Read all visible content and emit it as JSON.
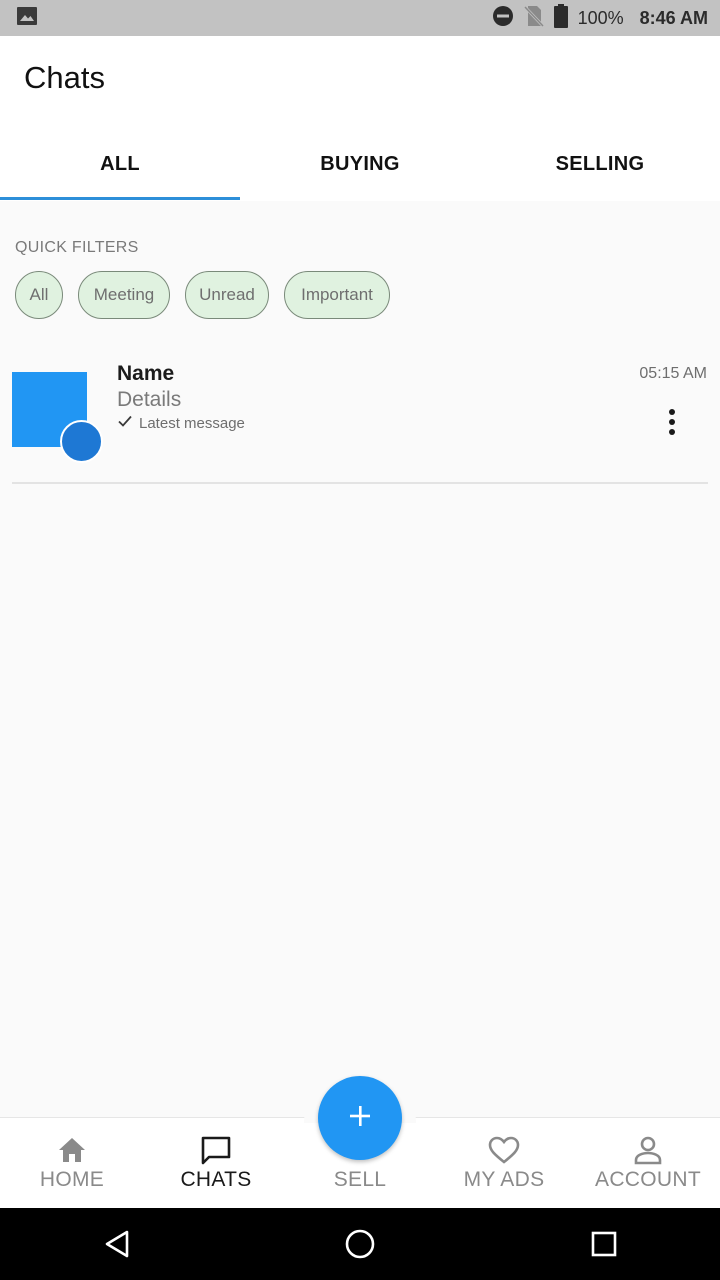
{
  "status_bar": {
    "battery": "100%",
    "time": "8:46 AM",
    "icons": [
      "image-icon",
      "do-not-disturb-icon",
      "no-sim-icon",
      "battery-icon"
    ]
  },
  "header": {
    "title": "Chats"
  },
  "tabs": [
    {
      "label": "ALL",
      "active": true
    },
    {
      "label": "BUYING",
      "active": false
    },
    {
      "label": "SELLING",
      "active": false
    }
  ],
  "accent_color": "#2196f3",
  "quick_filters": {
    "label": "QUICK FILTERS",
    "chips": [
      "All",
      "Meeting",
      "Unread",
      "Important"
    ]
  },
  "chats": [
    {
      "name": "Name",
      "details": "Details",
      "latest_message": "Latest message",
      "time": "05:15 AM",
      "read_icon": "check-icon",
      "menu_icon": "more-vert-icon"
    }
  ],
  "bottom_nav": {
    "items": [
      {
        "label": "HOME",
        "icon": "home-icon",
        "active": false
      },
      {
        "label": "CHATS",
        "icon": "chat-bubble-icon",
        "active": true
      },
      {
        "label": "SELL",
        "icon": "plus-icon",
        "active": false
      },
      {
        "label": "MY ADS",
        "icon": "heart-icon",
        "active": false
      },
      {
        "label": "ACCOUNT",
        "icon": "person-icon",
        "active": false
      }
    ]
  },
  "system_nav": {
    "icons": [
      "back-icon",
      "home-circle-icon",
      "recents-icon"
    ]
  }
}
